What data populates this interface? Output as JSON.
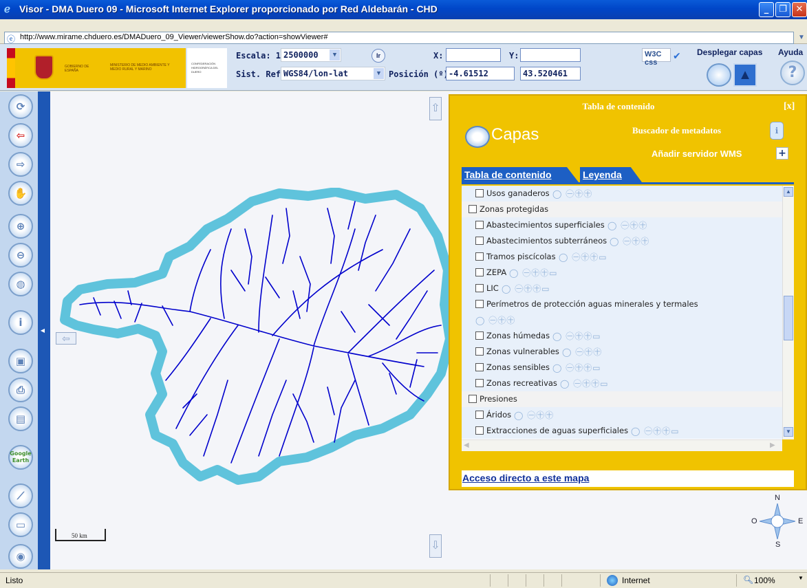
{
  "window": {
    "title": "Visor - DMA Duero 09 - Microsoft Internet Explorer proporcionado por Red Aldebarán - CHD",
    "minimize": "_",
    "maximize": "❐",
    "close": "✕"
  },
  "address": {
    "url": "http://www.mirame.chduero.es/DMADuero_09_Viewer/viewerShow.do?action=showViewer#"
  },
  "header": {
    "gov_label": "GOBIERNO DE ESPAÑA",
    "ministry_label": "MINISTERIO DE MEDIO AMBIENTE Y MEDIO RURAL Y MARINO",
    "chd_label": "CONFEDERACIÓN HIDROGRÁFICA DEL DUERO",
    "escala_label": "Escala: 1:",
    "escala_value": "2500000",
    "ir_label": "Ir",
    "x_label": "X:",
    "x_value": "",
    "y_label": "Y:",
    "y_value": "",
    "sistref_label": "Sist. Ref:",
    "sistref_value": "WGS84/lon-lat",
    "posicion_label": "Posición (º):",
    "pos_lon": "-4.61512",
    "pos_lat": "43.520461",
    "w3c_label": "W3C css",
    "desplegar_label": "Desplegar capas",
    "ayuda_label": "Ayuda"
  },
  "map": {
    "scale_label": "50 km",
    "compass": {
      "n": "N",
      "s": "S",
      "e": "E",
      "o": "O"
    },
    "google_earth": "Google Earth"
  },
  "toc": {
    "title": "Tabla de contenido",
    "close": "[x]",
    "capas_label": "Capas",
    "buscador_label": "Buscador de metadatos",
    "wms_label": "Añadir servidor WMS",
    "wms_add": "+",
    "tab_toc": "Tabla de contenido",
    "tab_legend": "Leyenda",
    "rows": [
      {
        "label": "Usos ganaderos",
        "level": "sub",
        "icons": "◯ ㊀㊉㊉"
      },
      {
        "label": "Zonas protegidas",
        "level": "grp",
        "icons": ""
      },
      {
        "label": "Abastecimientos superficiales",
        "level": "sub",
        "icons": "◯ ㊀㊉㊉"
      },
      {
        "label": "Abastecimientos subterráneos",
        "level": "sub",
        "icons": "◯ ㊀㊉㊉"
      },
      {
        "label": "Tramos piscícolas",
        "level": "sub",
        "icons": "◯ ㊀㊉㊉▭"
      },
      {
        "label": "ZEPA",
        "level": "sub",
        "icons": "◯ ㊀㊉㊉▭"
      },
      {
        "label": "LIC",
        "level": "sub",
        "icons": "◯ ㊀㊉㊉▭"
      },
      {
        "label": "Perímetros de protección aguas minerales y termales",
        "level": "sub",
        "icons": ""
      },
      {
        "label": "",
        "level": "sub",
        "icons": "◯ ㊀㊉㊉"
      },
      {
        "label": "Zonas húmedas",
        "level": "sub",
        "icons": "◯ ㊀㊉㊉▭"
      },
      {
        "label": "Zonas vulnerables",
        "level": "sub",
        "icons": "◯ ㊀㊉㊉"
      },
      {
        "label": "Zonas sensibles",
        "level": "sub",
        "icons": "◯ ㊀㊉㊉▭"
      },
      {
        "label": "Zonas recreativas",
        "level": "sub",
        "icons": "◯ ㊀㊉㊉▭"
      },
      {
        "label": "Presiones",
        "level": "grp",
        "icons": ""
      },
      {
        "label": "Áridos",
        "level": "sub",
        "icons": "◯ ㊀㊉㊉"
      },
      {
        "label": "Extracciones de aguas superficiales",
        "level": "sub",
        "icons": "◯ ㊀㊉㊉▭"
      }
    ],
    "acceso_link": "Acceso directo a este mapa"
  },
  "status": {
    "text": "Listo",
    "zone": "Internet",
    "zoom": "100%"
  },
  "colors": {
    "accent_blue": "#1d57b5",
    "toc_yellow": "#f0c300",
    "river_blue": "#0000cc",
    "basin_edge": "#5fc3dc"
  }
}
